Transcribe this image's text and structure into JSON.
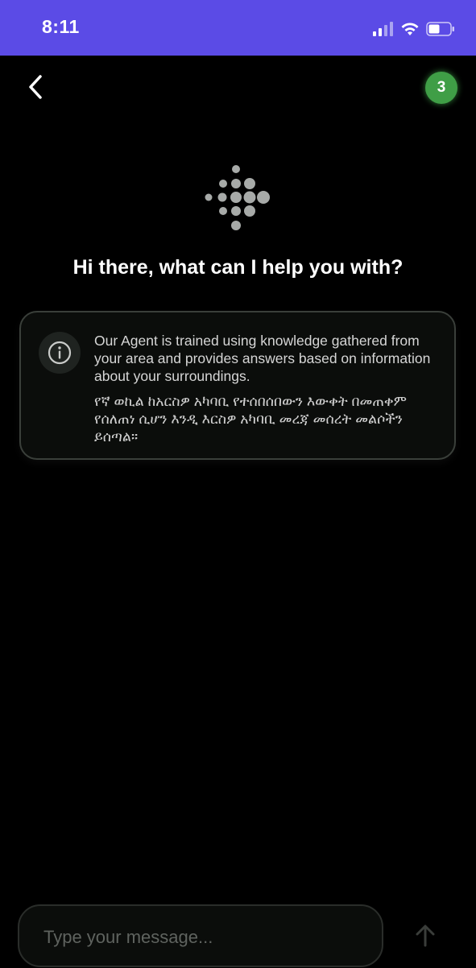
{
  "status_bar": {
    "time": "8:11",
    "background_color": "#5b4be6",
    "icons": [
      "cellular-signal-icon",
      "wifi-icon",
      "battery-icon"
    ]
  },
  "header": {
    "back_icon": "chevron-left-icon",
    "badge_count": "3",
    "badge_color": "#3f9e46"
  },
  "main": {
    "logo_icon": "dots-logo-icon",
    "greeting": "Hi there, what can I help you with?"
  },
  "info_card": {
    "icon": "info-icon",
    "text_en": "Our Agent is trained using knowledge gathered from your area and provides answers based on information about your surroundings.",
    "text_am": "የኛ ወኪል ከአርስዎ አካባቢ የተሰበሰበውን እውቀት በመጠቀም የሰለጠነ ሲሆን እንዲ እርስዎ አካባቢ መረጃ መሰረት መልሶችን ይሰጣል።"
  },
  "composer": {
    "placeholder": "Type your message...",
    "value": "",
    "send_icon": "arrow-up-icon"
  }
}
